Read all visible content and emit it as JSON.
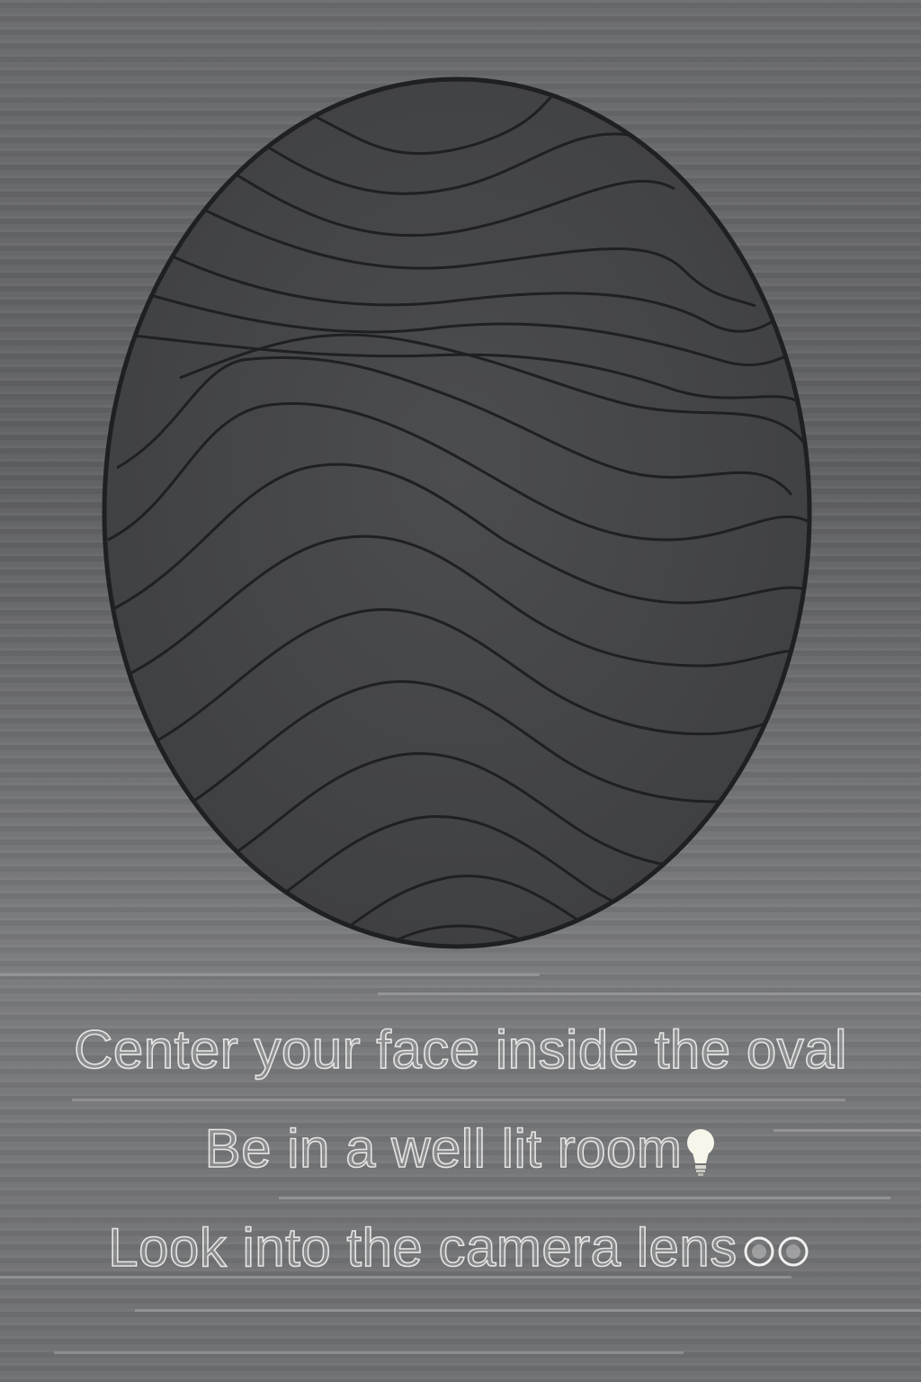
{
  "screen": {
    "name": "face-capture-guide",
    "background": "#6e6f71"
  },
  "oval": {
    "icon": "face-oval-guide-icon",
    "stroke_color": "#1f2021",
    "fill_color": "#4a4b4d"
  },
  "instructions": {
    "line1": "Center your face inside the oval",
    "line2": "Be in a well lit room",
    "line2_icon": "lightbulb-icon",
    "line3": "Look into the camera lens",
    "line3_icon": "eyes-icon",
    "text_color": "#f0f0f0"
  }
}
